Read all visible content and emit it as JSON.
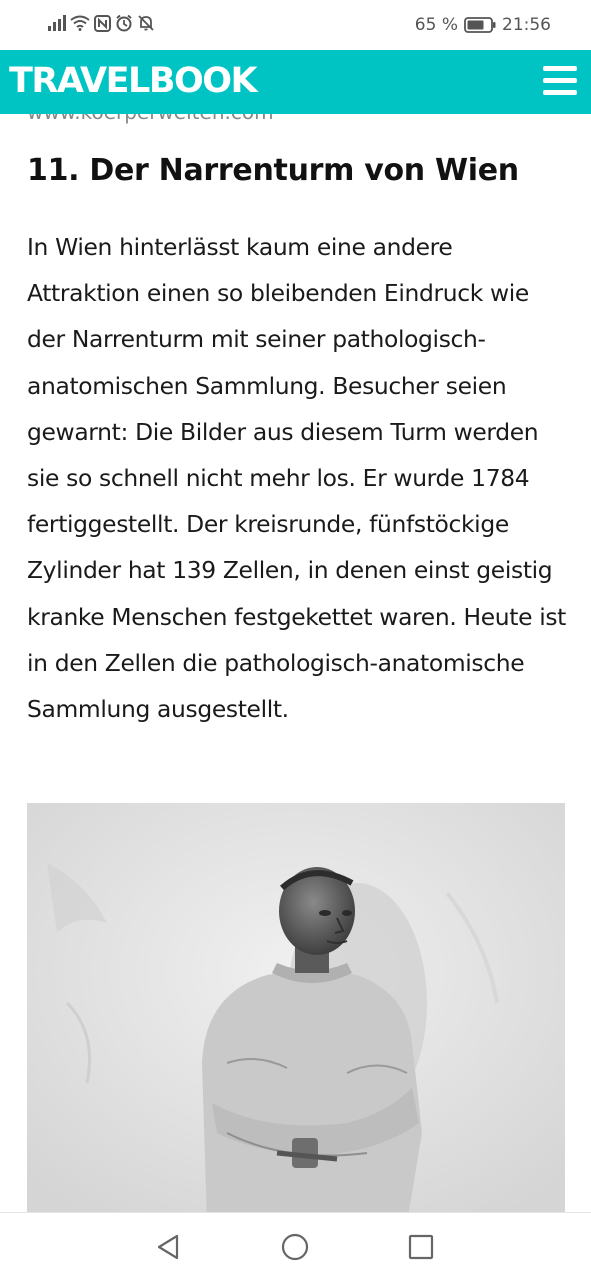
{
  "status_bar": {
    "battery_percent": "65 %",
    "time": "21:56",
    "icons": [
      "signal-icon",
      "wifi-icon",
      "nfc-icon",
      "alarm-icon",
      "notifications-off-icon",
      "battery-icon"
    ]
  },
  "header": {
    "brand": "TRAVELBOOK",
    "menu_icon": "hamburger-menu-icon",
    "brand_color": "#00c4c4"
  },
  "article": {
    "image_credit": "www.koerperwelten.com",
    "heading": "11. Der Narrenturm von Wien",
    "body": "In Wien hinterlässt kaum eine andere Attraktion einen so bleibenden Eindruck wie der Narrenturm mit seiner pathologisch-anatomischen Sammlung. Besucher seien gewarnt: Die Bilder aus diesem Turm werden sie so schnell nicht mehr los. Er wurde 1784 fertiggestellt. Der kreisrunde, fünfstöckige Zylinder hat 139 Zellen, in denen einst geistig kranke Menschen festgekettet waren. Heute ist in den Zellen die pathologisch-anatomische Sammlung ausgestellt."
  },
  "nav_bar": {
    "back_icon": "back-triangle-icon",
    "home_icon": "home-circle-icon",
    "recents_icon": "recents-square-icon"
  }
}
